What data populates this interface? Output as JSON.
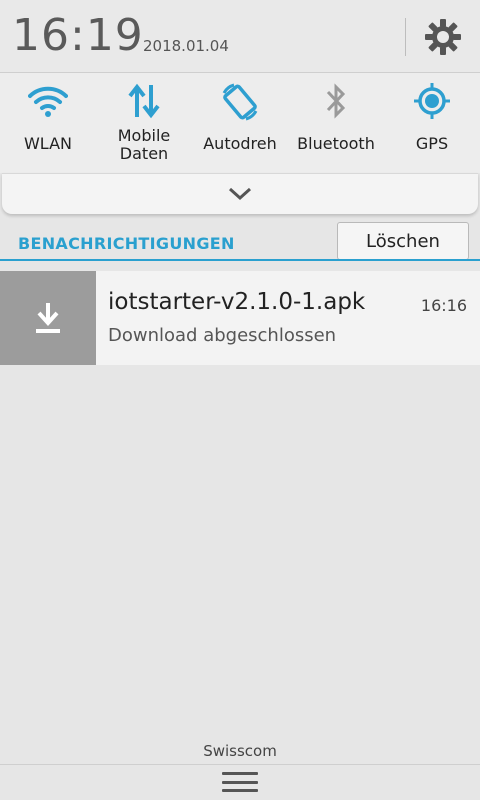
{
  "status": {
    "time": "16:19",
    "date": "2018.01.04"
  },
  "quick_settings": {
    "items": [
      {
        "label": "WLAN",
        "icon": "wifi-icon"
      },
      {
        "label": "Mobile Daten",
        "icon": "mobile-data-icon"
      },
      {
        "label": "Autodreh",
        "icon": "auto-rotate-icon"
      },
      {
        "label": "Bluetooth",
        "icon": "bluetooth-icon"
      },
      {
        "label": "GPS",
        "icon": "gps-icon"
      }
    ]
  },
  "notifications": {
    "header": "BENACHRICHTIGUNGEN",
    "clear_label": "Löschen",
    "items": [
      {
        "title": "iotstarter-v2.1.0-1.apk",
        "subtitle": "Download abgeschlossen",
        "time": "16:16",
        "icon": "download-icon"
      }
    ]
  },
  "footer": {
    "carrier": "Swisscom"
  },
  "colors": {
    "accent": "#2aa0cf",
    "icon_blue": "#2e9fd0",
    "background": "#e6e6e6",
    "notification_icon_bg": "#9c9c9c"
  }
}
